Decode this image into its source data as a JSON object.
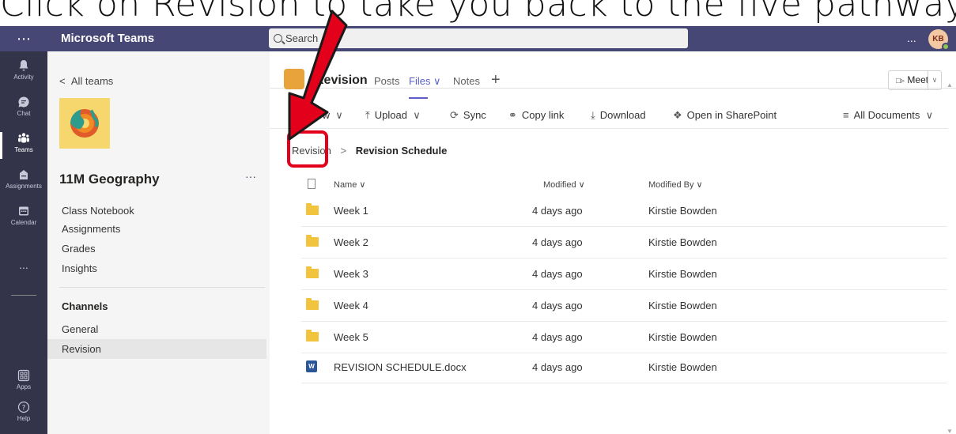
{
  "caption": "Click on Revision to take you back to the five pathways",
  "topbar": {
    "app_title": "Microsoft Teams",
    "search_placeholder": "Search",
    "more_label": "...",
    "avatar_initials": "KB"
  },
  "rail": [
    {
      "label": "Activity",
      "icon": "bell-icon"
    },
    {
      "label": "Chat",
      "icon": "chat-icon"
    },
    {
      "label": "Teams",
      "icon": "teams-icon"
    },
    {
      "label": "Assignments",
      "icon": "assignments-icon"
    },
    {
      "label": "Calendar",
      "icon": "calendar-icon"
    },
    {
      "label": "...",
      "icon": "more-icon"
    },
    {
      "label": "Apps",
      "icon": "apps-icon"
    },
    {
      "label": "Help",
      "icon": "help-icon"
    }
  ],
  "team_panel": {
    "back_label": "All teams",
    "team_name": "11M Geography",
    "more_label": "···",
    "links": [
      "Class Notebook",
      "Assignments",
      "Grades",
      "Insights"
    ],
    "channels_heading": "Channels",
    "channels": [
      "General",
      "Revision"
    ]
  },
  "channel": {
    "title": "Revision",
    "tabs": [
      "Posts",
      "Files ∨",
      "Notes"
    ],
    "meet_label": "Meet"
  },
  "toolbar": {
    "new_label": "New",
    "upload_label": "Upload",
    "sync_label": "Sync",
    "copy_link_label": "Copy link",
    "download_label": "Download",
    "open_sharepoint_label": "Open in SharePoint",
    "view_label": "All Documents"
  },
  "breadcrumb": {
    "root": "Revision",
    "current": "Revision Schedule"
  },
  "table": {
    "headers": {
      "name": "Name ∨",
      "modified": "Modified ∨",
      "modified_by": "Modified By ∨"
    },
    "rows": [
      {
        "type": "folder",
        "name": "Week 1",
        "modified": "4 days ago",
        "by": "Kirstie Bowden"
      },
      {
        "type": "folder",
        "name": "Week 2",
        "modified": "4 days ago",
        "by": "Kirstie Bowden"
      },
      {
        "type": "folder",
        "name": "Week 3",
        "modified": "4 days ago",
        "by": "Kirstie Bowden"
      },
      {
        "type": "folder",
        "name": "Week 4",
        "modified": "4 days ago",
        "by": "Kirstie Bowden"
      },
      {
        "type": "folder",
        "name": "Week 5",
        "modified": "4 days ago",
        "by": "Kirstie Bowden"
      },
      {
        "type": "docx",
        "name": "REVISION SCHEDULE.docx",
        "modified": "4 days ago",
        "by": "Kirstie Bowden"
      }
    ]
  },
  "colors": {
    "topbar": "#464775",
    "rail": "#33344a",
    "accent": "#5b5fc7",
    "highlight": "#e3001b"
  }
}
